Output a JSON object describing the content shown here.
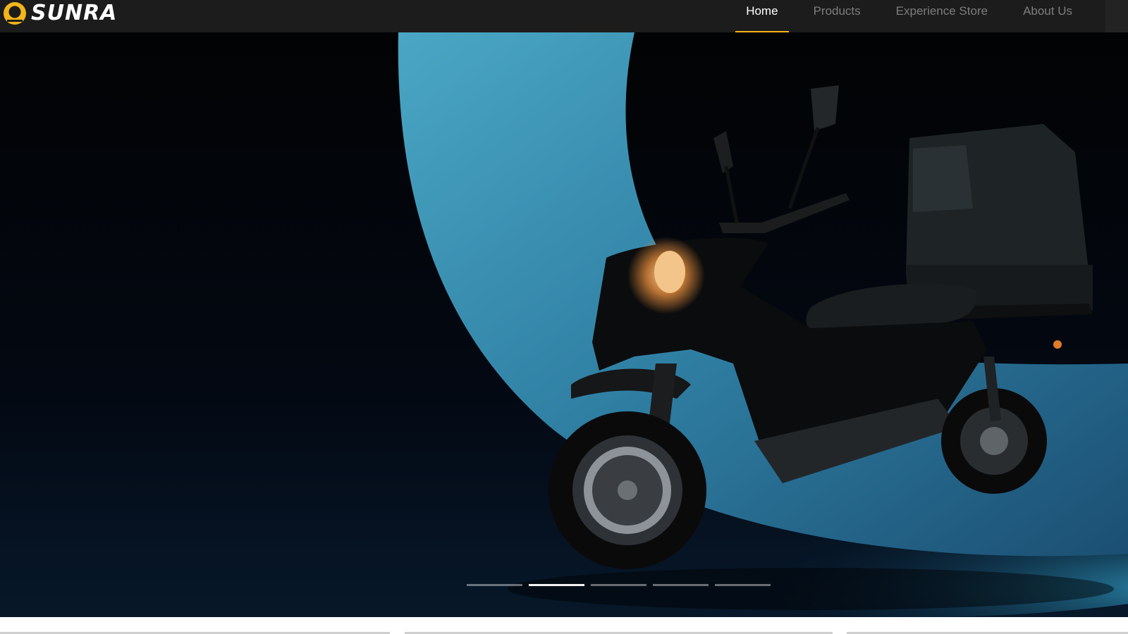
{
  "brand": {
    "name": "SUNRA",
    "accent_color": "#f2b51a",
    "logo_icon": "sunra-logo-icon"
  },
  "nav": {
    "items": [
      {
        "label": "Home",
        "active": true
      },
      {
        "label": "Products",
        "active": false
      },
      {
        "label": "Experience Store",
        "active": false
      },
      {
        "label": "About Us",
        "active": false
      }
    ]
  },
  "hero": {
    "image": "electric-scooter-with-delivery-box",
    "slides_total": 5,
    "active_slide": 2
  }
}
